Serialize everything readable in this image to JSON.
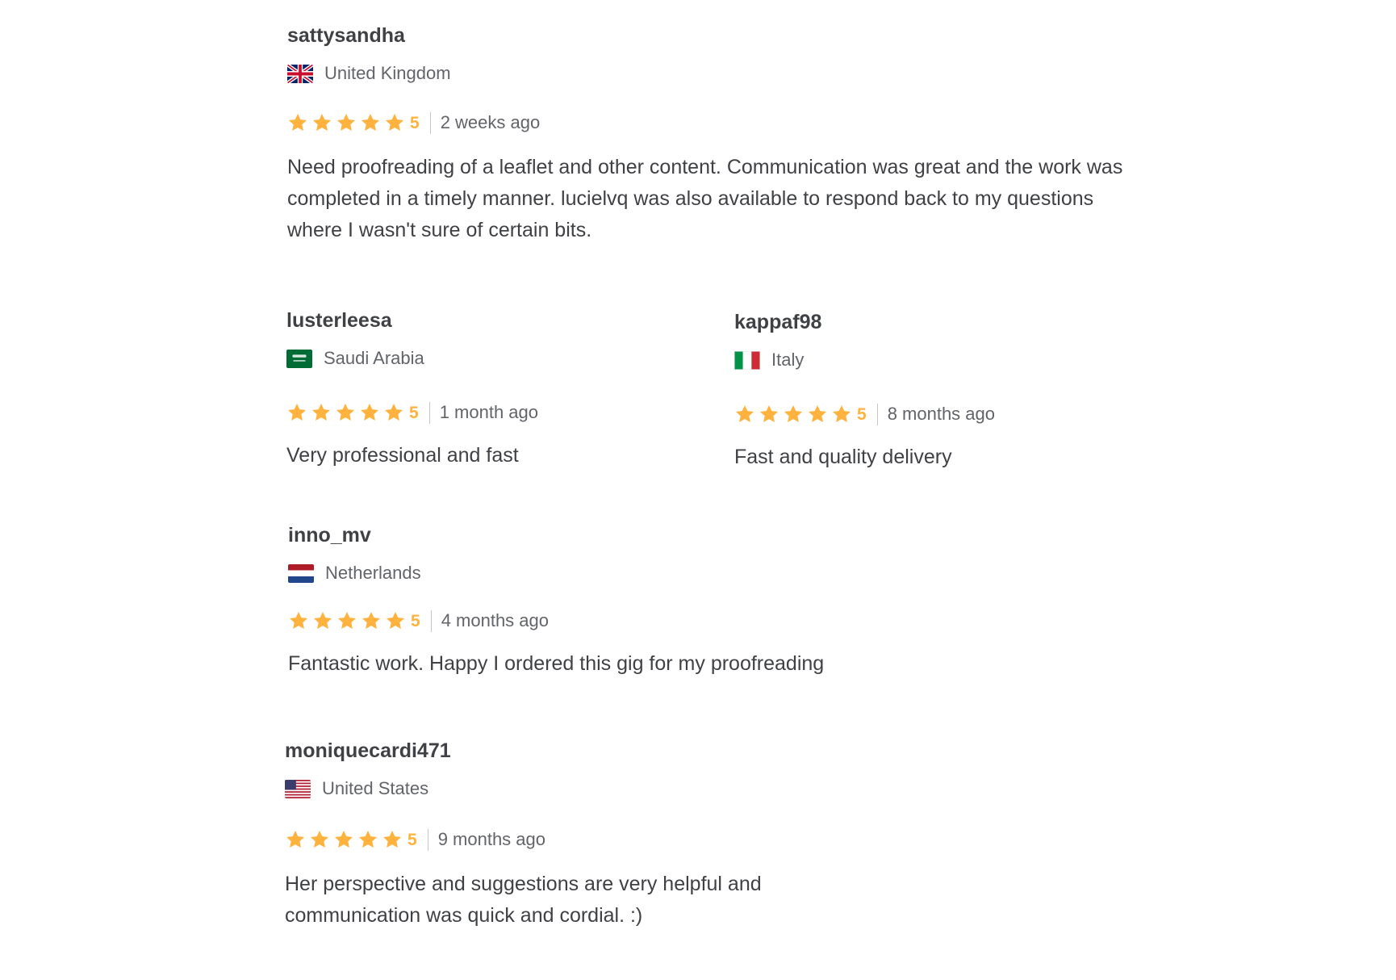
{
  "reviews": [
    {
      "username": "sattysandha",
      "country": "United Kingdom",
      "flag": "uk-flag-icon",
      "rating": 5,
      "score_label": "5",
      "time": "2 weeks ago",
      "text": "Need proofreading of a leaflet and other content. Communication was great and the work was completed in a timely manner. lucielvq was also available to respond back to my questions where I wasn't sure of certain bits."
    },
    {
      "username": "lusterleesa",
      "country": "Saudi Arabia",
      "flag": "saudi-arabia-flag-icon",
      "rating": 5,
      "score_label": "5",
      "time": "1 month ago",
      "text": "Very professional and fast"
    },
    {
      "username": "kappaf98",
      "country": "Italy",
      "flag": "italy-flag-icon",
      "rating": 5,
      "score_label": "5",
      "time": "8 months ago",
      "text": "Fast and quality delivery"
    },
    {
      "username": "inno_mv",
      "country": "Netherlands",
      "flag": "netherlands-flag-icon",
      "rating": 5,
      "score_label": "5",
      "time": "4 months ago",
      "text": "Fantastic work. Happy I ordered this gig for my proofreading"
    },
    {
      "username": "moniquecardi471",
      "country": "United States",
      "flag": "usa-flag-icon",
      "rating": 5,
      "score_label": "5",
      "time": "9 months ago",
      "text": "Her perspective and suggestions are very helpful and communication was quick and cordial. :)"
    }
  ],
  "colors": {
    "star": "#ffb33e",
    "text": "#404145",
    "muted": "#62646a",
    "divider": "#c5c6c9"
  }
}
